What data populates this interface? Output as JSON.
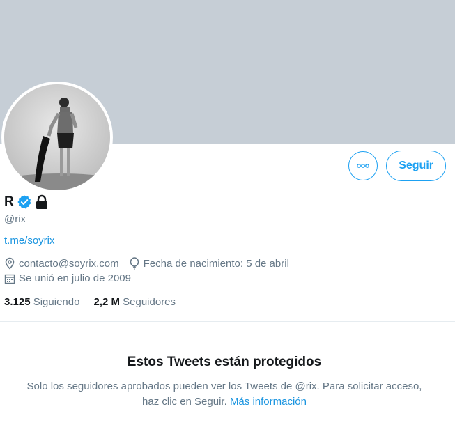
{
  "profile": {
    "name": "R",
    "handle": "@rix",
    "link": "t.me/soyrix",
    "email": "contacto@soyrix.com",
    "birthday": "Fecha de nacimiento: 5 de abril",
    "joined": "Se unió en julio de 2009"
  },
  "stats": {
    "following_count": "3.125",
    "following_label": "Siguiendo",
    "followers_count": "2,2 M",
    "followers_label": "Seguidores"
  },
  "actions": {
    "follow_label": "Seguir",
    "more_icon": "more-icon"
  },
  "protected": {
    "title": "Estos Tweets están protegidos",
    "line1": "Solo los seguidores aprobados pueden ver los Tweets de @rix. Para solicitar acceso,",
    "line2": "haz clic en Seguir.",
    "more_info": "Más información"
  },
  "icons": {
    "verified": "verified-badge-icon",
    "protected": "lock-icon",
    "location": "location-pin-icon",
    "birthday": "balloon-icon",
    "calendar": "calendar-icon"
  },
  "colors": {
    "accent": "#1da1f2",
    "banner": "#c6ced6",
    "secondary_text": "#657786"
  }
}
